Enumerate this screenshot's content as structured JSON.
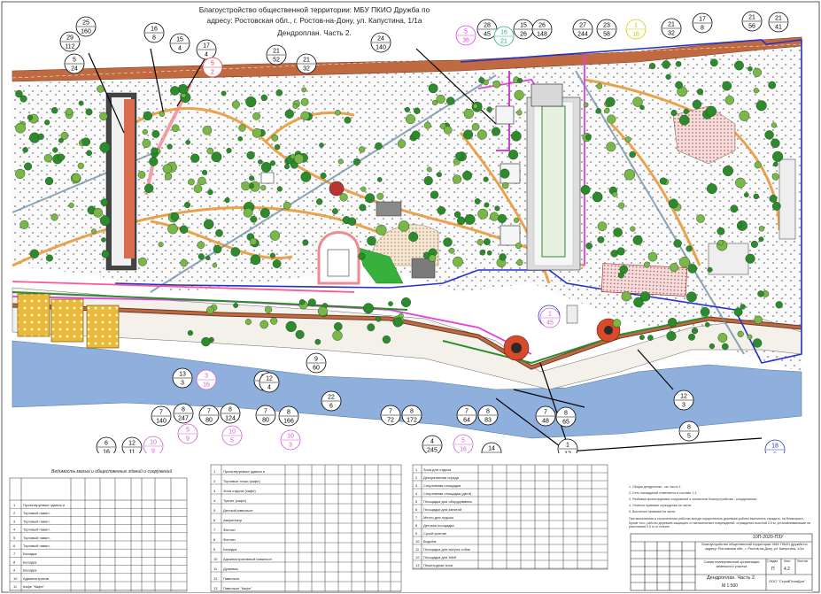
{
  "header": {
    "line1": "Благоустройство общественной территории:  МБУ ПКИО Дружба по",
    "line2": "адресу: Ростовская обл.,  г. Ростов-на-Дону, ул. Капустина, 1/1а",
    "line3": "Дендроплан. Часть 2."
  },
  "callouts": [
    {
      "top": "25",
      "bottom": "160"
    },
    {
      "top": "29",
      "bottom": "112"
    },
    {
      "top": "5",
      "bottom": "24"
    },
    {
      "top": "16",
      "bottom": "8"
    },
    {
      "top": "15",
      "bottom": "4"
    },
    {
      "top": "17",
      "bottom": "4"
    },
    {
      "top": "5",
      "bottom": "2"
    },
    {
      "top": "21",
      "bottom": "52"
    },
    {
      "top": "21",
      "bottom": "32"
    },
    {
      "top": "24",
      "bottom": "140"
    },
    {
      "top": "5",
      "bottom": "36"
    },
    {
      "top": "28",
      "bottom": "45"
    },
    {
      "top": "16",
      "bottom": "21"
    },
    {
      "top": "15",
      "bottom": "26"
    },
    {
      "top": "26",
      "bottom": "148"
    },
    {
      "top": "27",
      "bottom": "244"
    },
    {
      "top": "23",
      "bottom": "58"
    },
    {
      "top": "1",
      "bottom": "16"
    },
    {
      "top": "21",
      "bottom": "32"
    },
    {
      "top": "17",
      "bottom": "8"
    },
    {
      "top": "21",
      "bottom": "56"
    },
    {
      "top": "21",
      "bottom": "41"
    },
    {
      "top": "13",
      "bottom": "3"
    },
    {
      "top": "3",
      "bottom": "16"
    },
    {
      "top": "7",
      "bottom": "140"
    },
    {
      "top": "8",
      "bottom": "247"
    },
    {
      "top": "7",
      "bottom": "80"
    },
    {
      "top": "8",
      "bottom": "124"
    },
    {
      "top": "13",
      "bottom": "4"
    },
    {
      "top": "7",
      "bottom": "80"
    },
    {
      "top": "8",
      "bottom": "166"
    },
    {
      "top": "9",
      "bottom": "60"
    },
    {
      "top": "22",
      "bottom": "6"
    },
    {
      "top": "7",
      "bottom": "72"
    },
    {
      "top": "8",
      "bottom": "172"
    },
    {
      "top": "7",
      "bottom": "64"
    },
    {
      "top": "8",
      "bottom": "83"
    },
    {
      "top": "7",
      "bottom": "48"
    },
    {
      "top": "8",
      "bottom": "65"
    },
    {
      "top": "12",
      "bottom": "3"
    },
    {
      "top": "6",
      "bottom": "16"
    },
    {
      "top": "12",
      "bottom": "11"
    },
    {
      "top": "10",
      "bottom": "9"
    },
    {
      "top": "5",
      "bottom": "9"
    },
    {
      "top": "10",
      "bottom": "5"
    },
    {
      "top": "10",
      "bottom": "3"
    },
    {
      "top": "4",
      "bottom": "245"
    },
    {
      "top": "5",
      "bottom": "16"
    },
    {
      "top": "14",
      "bottom": "6"
    },
    {
      "top": "1",
      "bottom": "12"
    },
    {
      "top": "8",
      "bottom": "5"
    },
    {
      "top": "18",
      "bottom": "6"
    },
    {
      "top": "1",
      "bottom": "45"
    },
    {
      "top": "12",
      "bottom": "4"
    }
  ],
  "tables": {
    "left_title": "Ведомость малых и общественных зданий и сооружений",
    "left_rows": [
      "Проектируемые здания и",
      "Торговый павил.",
      "Торговый павил.",
      "Торговый павил.",
      "Торговый павил.",
      "Торговый павил.",
      "Беседка",
      "Беседка",
      "Беседка",
      "Административ.",
      "Кафе \"Кафе\""
    ],
    "mid_rows": [
      "Проектируемые здания и",
      "Торговые точки (кафе)",
      "Зона отдыха (кафе)",
      "Туалет (кафе)",
      "Детский павильон",
      "Амфитеатр",
      "Фонтан",
      "Фонтан",
      "Беседка",
      "Административный павильон",
      "Душевая",
      "Павильон",
      "Павильон \"Кафе\""
    ],
    "right_rows": [
      "Зона для отдыха",
      "Декоративная ограда",
      "Спортивная площадка",
      "Спортивная площадка (дети)",
      "Площадка для оборудования",
      "Площадки для занятий",
      "Место для отдыха",
      "Детская площадка",
      "Сухой фонтан",
      "Водоём",
      "Площадка для выгула собак",
      "Площадка для МАФ",
      "Пешеходная зона"
    ]
  },
  "notes": [
    "1. Общая дендроплан - см. часть 1.",
    "2. Сеть насаждений отмечается в составе 1.1.",
    "3. Разбивка проектируемых сооружений и элементов благоустройства - координатная.",
    "4. Отметки привязки ограждения на части.",
    "5. Высотные привязки на части."
  ],
  "note_long": "При выполнении и строительных работах всегда осуществлять деревьев работы выполнять оградить, на близкорасп. Кроме того, работы деревьев защищать от механических повреждений, ограждения высотой 2,0 м, устанавливаемыми на расстоянии 0,5 м от ствола.",
  "title_block": {
    "code": "10П-2020-ПЗУ",
    "desc": "Благоустройство общественной территории: МБУ ПКИО Дружба по адресу: Ростовская обл., г. Ростов-на-Дону, ул. Капустина, 1/1а",
    "section": "Схема планировочной организации земельного участка",
    "stage_h": "Стадия",
    "sheet_h": "Лист",
    "sheets_h": "Листов",
    "stage": "П",
    "sheet": "4.2",
    "drawing": "Дендроплан. Часть 2.",
    "scale": "М 1:500",
    "org": "ООО \"СтройПланДон\""
  },
  "colors": {
    "water": "#8fb0dd",
    "road": "#c06a42",
    "orange_path": "#e89a3a",
    "blue_boundary": "#2233cc",
    "magenta_line": "#e040e0",
    "green_tree": "#2d8a2d"
  }
}
